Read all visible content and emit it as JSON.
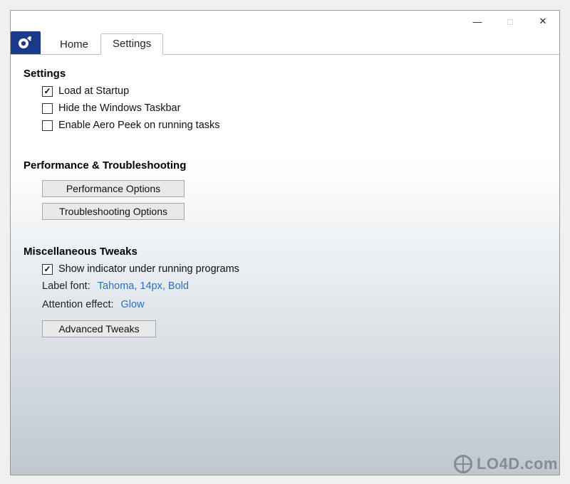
{
  "tabs": {
    "home": "Home",
    "settings": "Settings"
  },
  "sections": {
    "settings": {
      "title": "Settings",
      "load_at_startup": "Load at Startup",
      "hide_taskbar": "Hide the Windows Taskbar",
      "enable_aero_peek": "Enable Aero Peek on running tasks"
    },
    "perf": {
      "title": "Performance & Troubleshooting",
      "perf_options_btn": "Performance Options",
      "trouble_options_btn": "Troubleshooting Options"
    },
    "misc": {
      "title": "Miscellaneous Tweaks",
      "show_indicator": "Show indicator under running programs",
      "label_font_key": "Label font:",
      "label_font_val": "Tahoma, 14px, Bold",
      "attention_key": "Attention effect:",
      "attention_val": "Glow",
      "advanced_btn": "Advanced Tweaks"
    }
  },
  "checkbox_state": {
    "load_at_startup": true,
    "hide_taskbar": false,
    "enable_aero_peek": false,
    "show_indicator": true
  },
  "watermark": "LO4D.com"
}
